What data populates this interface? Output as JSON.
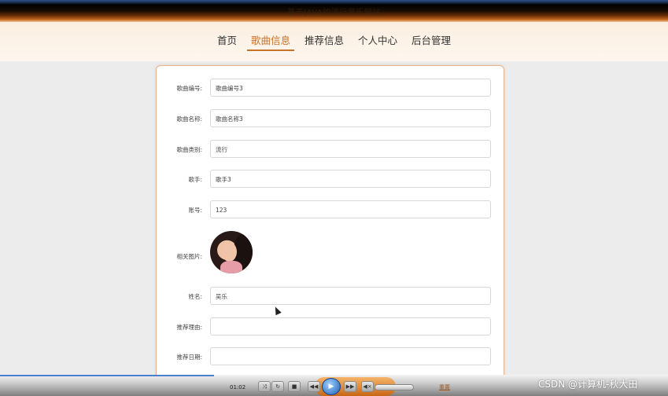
{
  "site": {
    "title": "基于JAVA的流行音乐网站"
  },
  "nav": {
    "items": [
      "首页",
      "歌曲信息",
      "推荐信息",
      "个人中心",
      "后台管理"
    ],
    "active_index": 1
  },
  "form": {
    "song_no": {
      "label": "歌曲编号:",
      "value": "歌曲编号3"
    },
    "song_name": {
      "label": "歌曲名称:",
      "value": "歌曲名称3"
    },
    "song_type": {
      "label": "歌曲类别:",
      "value": "流行"
    },
    "singer": {
      "label": "歌手:",
      "value": "歌手3"
    },
    "account": {
      "label": "账号:",
      "value": "123"
    },
    "image": {
      "label": "相关图片:"
    },
    "name": {
      "label": "姓名:",
      "value": "吴乐"
    },
    "reason": {
      "label": "推荐理由:",
      "value": ""
    },
    "date": {
      "label": "推荐日期:",
      "value": ""
    }
  },
  "player": {
    "time": "01:02",
    "reset_label": "重置"
  },
  "watermark": "CSDN @计算机-秋大田",
  "colors": {
    "accent": "#c8742c",
    "card_border": "#e8b48d"
  },
  "icons": {
    "cursor": "pointer-arrow-icon",
    "play": "play-icon"
  }
}
